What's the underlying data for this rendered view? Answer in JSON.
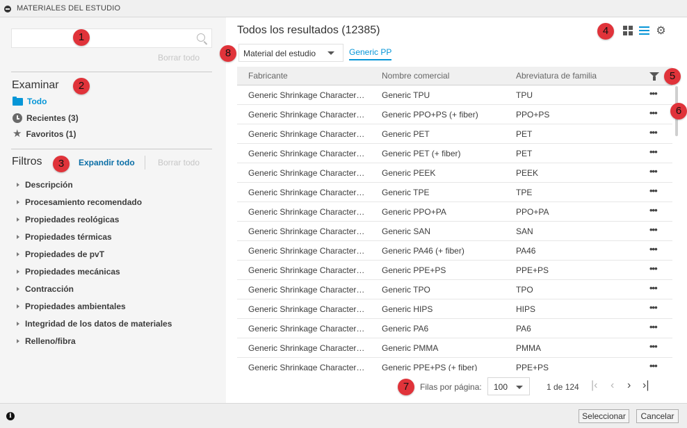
{
  "window": {
    "title": "MATERIALES DEL ESTUDIO"
  },
  "sidebar": {
    "search": {
      "placeholder": "",
      "clear_label": "Borrar todo"
    },
    "browse": {
      "title": "Examinar",
      "items": [
        {
          "label": "Todo",
          "icon": "folder-icon",
          "active": true
        },
        {
          "label": "Recientes (3)",
          "icon": "clock-icon",
          "active": false
        },
        {
          "label": "Favoritos (1)",
          "icon": "star-icon",
          "active": false
        }
      ]
    },
    "filters": {
      "title": "Filtros",
      "expand_label": "Expandir todo",
      "clear_label": "Borrar todo",
      "items": [
        "Descripción",
        "Procesamiento recomendado",
        "Propiedades reológicas",
        "Propiedades térmicas",
        "Propiedades de pvT",
        "Propiedades mecánicas",
        "Contracción",
        "Propiedades ambientales",
        "Integridad de los datos de materiales",
        "Relleno/fibra"
      ]
    }
  },
  "main": {
    "title": "Todos los resultados (12385)",
    "source_dropdown": {
      "value": "Material del estudio"
    },
    "active_chip": "Generic PP",
    "view_icons": [
      "grid-view-icon",
      "list-view-icon",
      "gear-icon"
    ],
    "table": {
      "columns": [
        "Fabricante",
        "Nombre comercial",
        "Abreviatura de familia"
      ],
      "rows": [
        [
          "Generic Shrinkage Characterization",
          "Generic TPU",
          "TPU"
        ],
        [
          "Generic Shrinkage Characterization",
          "Generic PPO+PS (+ fiber)",
          "PPO+PS"
        ],
        [
          "Generic Shrinkage Characterization",
          "Generic PET",
          "PET"
        ],
        [
          "Generic Shrinkage Characterization",
          "Generic PET (+ fiber)",
          "PET"
        ],
        [
          "Generic Shrinkage Characterization",
          "Generic PEEK",
          "PEEK"
        ],
        [
          "Generic Shrinkage Characterization",
          "Generic TPE",
          "TPE"
        ],
        [
          "Generic Shrinkage Characterization",
          "Generic PPO+PA",
          "PPO+PA"
        ],
        [
          "Generic Shrinkage Characterization",
          "Generic SAN",
          "SAN"
        ],
        [
          "Generic Shrinkage Characterization",
          "Generic PA46 (+ fiber)",
          "PA46"
        ],
        [
          "Generic Shrinkage Characterization",
          "Generic PPE+PS",
          "PPE+PS"
        ],
        [
          "Generic Shrinkage Characterization",
          "Generic TPO",
          "TPO"
        ],
        [
          "Generic Shrinkage Characterization",
          "Generic HIPS",
          "HIPS"
        ],
        [
          "Generic Shrinkage Characterization",
          "Generic PA6",
          "PA6"
        ],
        [
          "Generic Shrinkage Characterization",
          "Generic PMMA",
          "PMMA"
        ],
        [
          "Generic Shrinkage Characterization",
          "Generic PPE+PS (+ fiber)",
          "PPE+PS"
        ]
      ],
      "row_action": "•••"
    },
    "pagination": {
      "rows_label": "Filas por página:",
      "rows_per_page": "100",
      "page_info": "1 de 124",
      "first": "|<",
      "prev": "<",
      "next": ">",
      "last": ">|"
    }
  },
  "footer": {
    "select_label": "Seleccionar",
    "cancel_label": "Cancelar"
  },
  "callouts": [
    "1",
    "2",
    "3",
    "4",
    "5",
    "6",
    "7",
    "8"
  ],
  "colors": {
    "accent": "#0696d7",
    "callout": "#e0333a",
    "sidebar_bg": "#f5f5f5"
  }
}
